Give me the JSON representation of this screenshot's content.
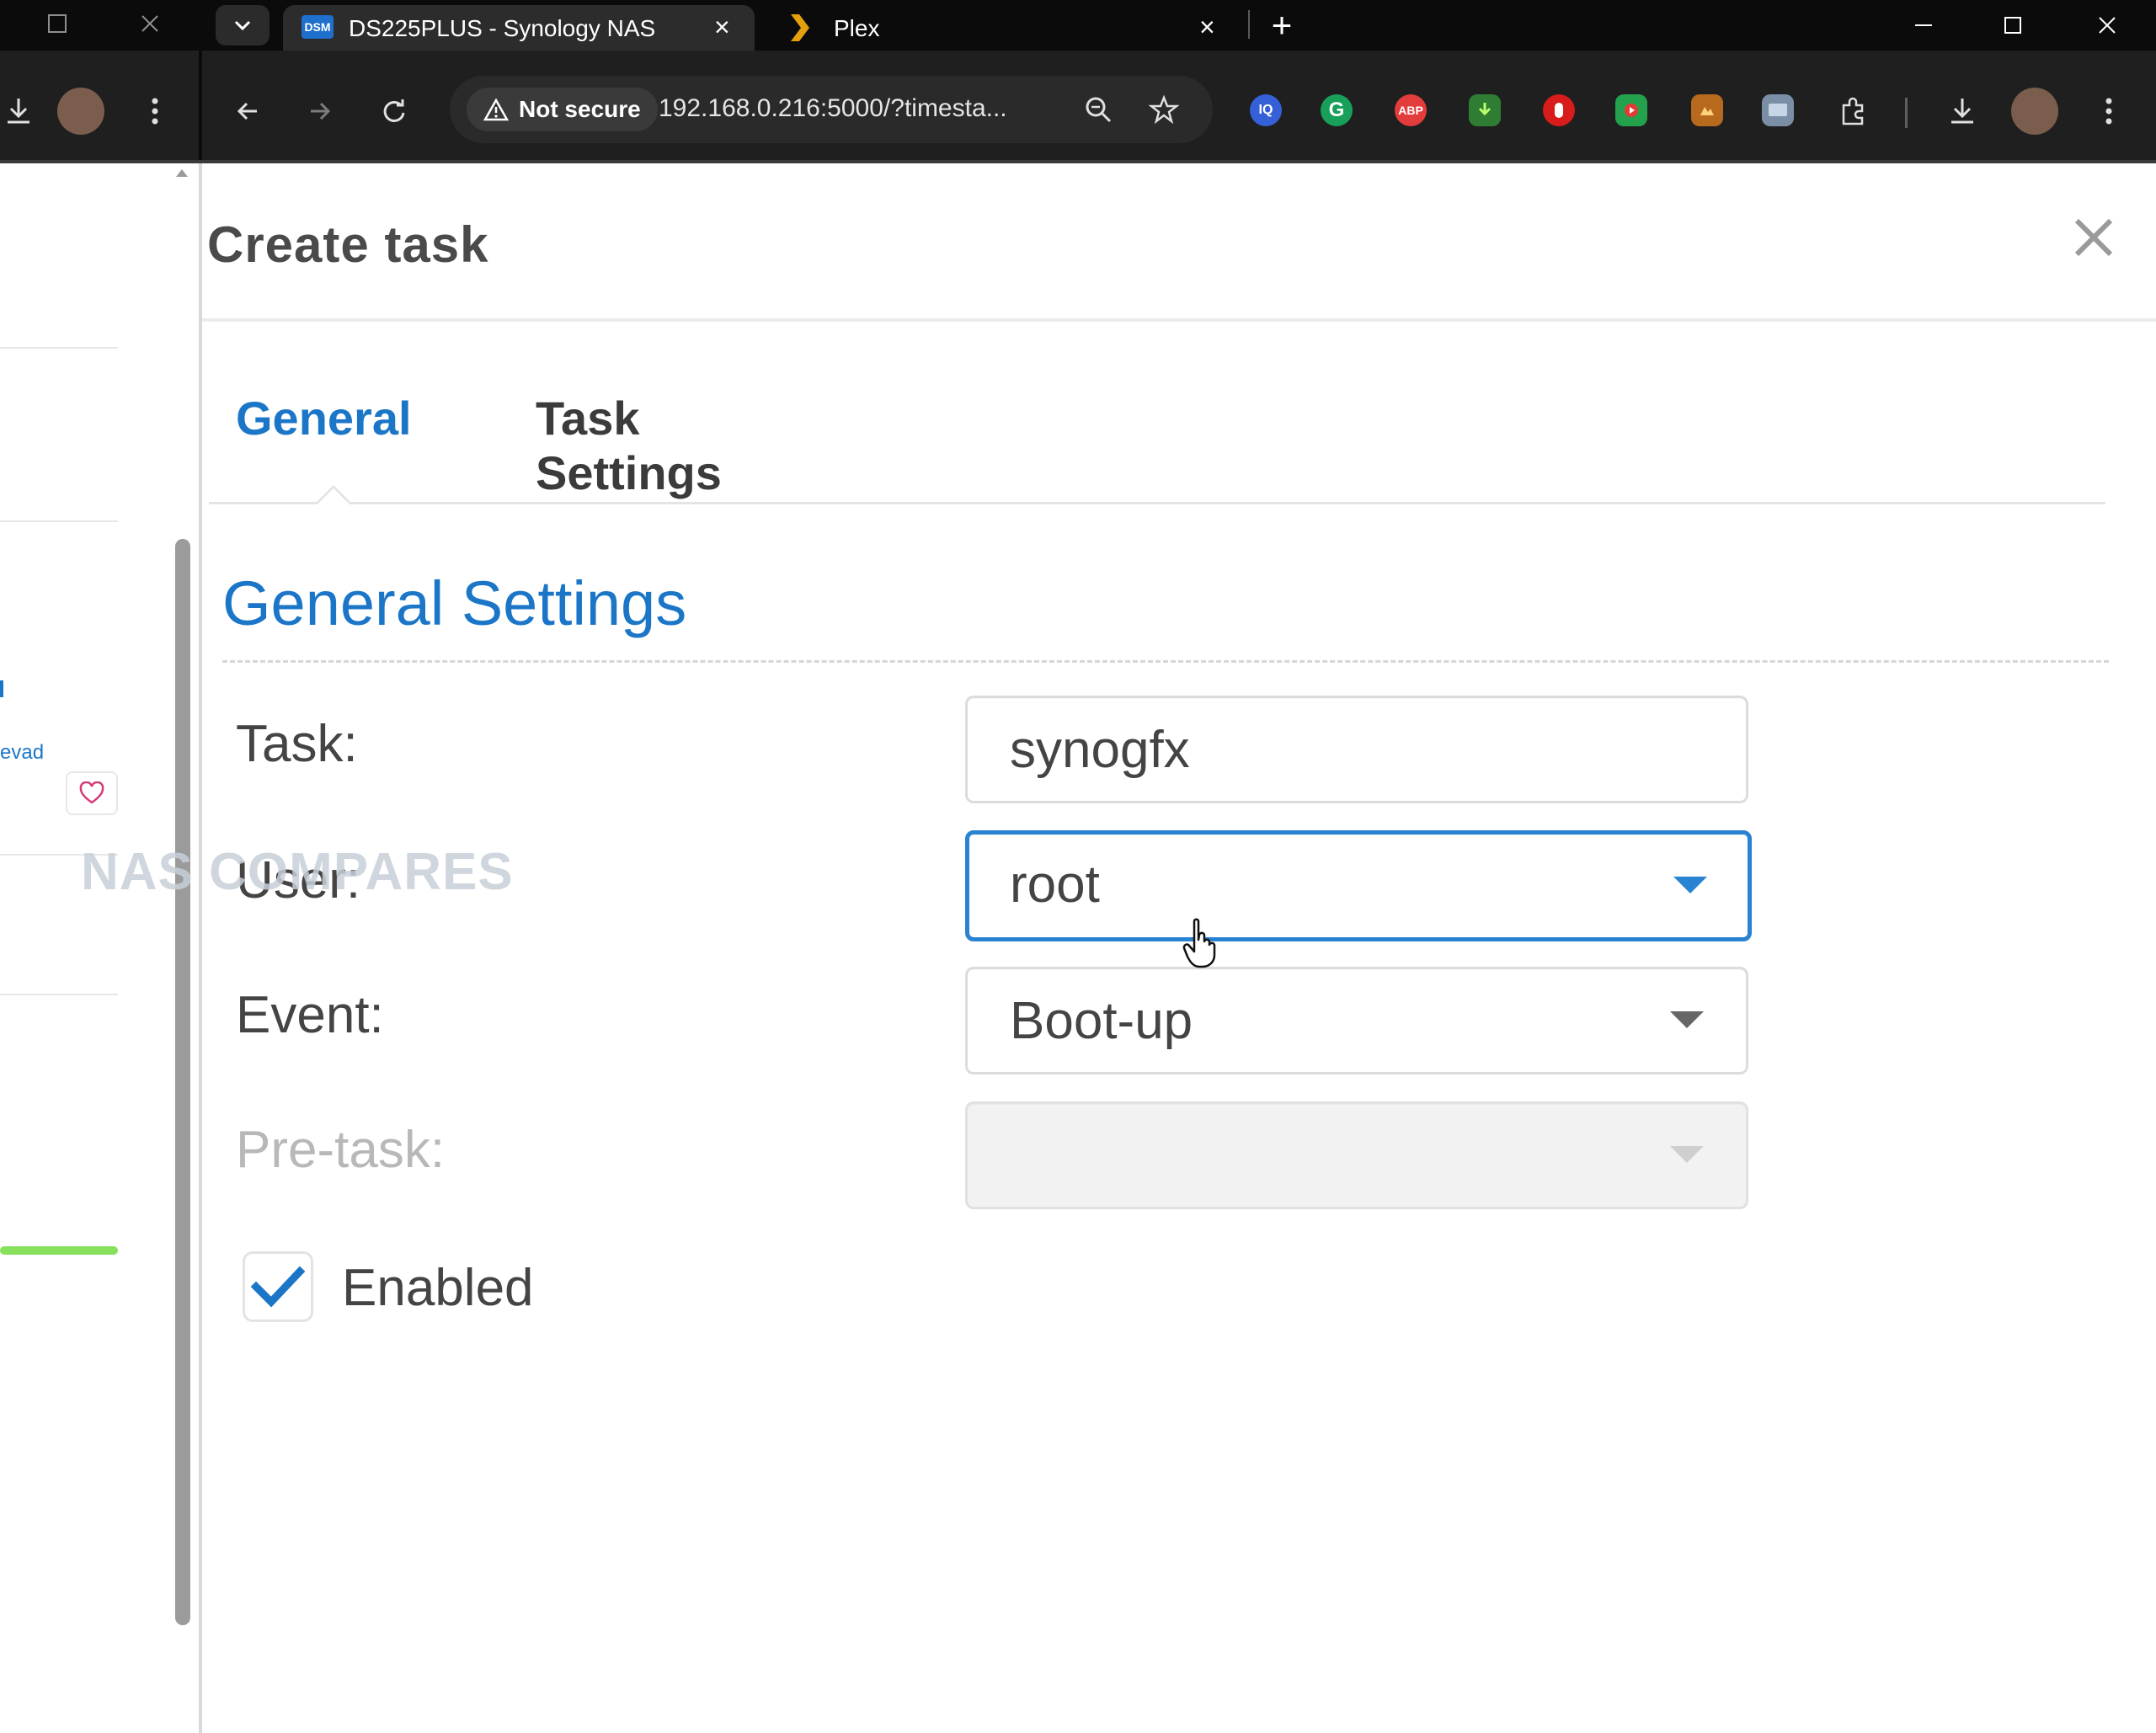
{
  "browser": {
    "tabs": [
      {
        "title": "DS225PLUS - Synology NAS",
        "favicon": "dsm-icon"
      },
      {
        "title": "Plex",
        "favicon": "plex-icon"
      }
    ],
    "address": {
      "security_label": "Not secure",
      "url": "192.168.0.216:5000/?timesta..."
    },
    "extensions": [
      "lastpass-icon",
      "grammarly-icon",
      "adblock-icon",
      "download-ext-icon",
      "hand-ext-icon",
      "video-ext-icon",
      "aura-ext-icon",
      "screen-ext-icon"
    ]
  },
  "left_panel": {
    "link_text": "evad"
  },
  "dialog": {
    "title": "Create task",
    "tabs": [
      {
        "label": "General",
        "active": true
      },
      {
        "label": "Task Settings",
        "active": false
      }
    ],
    "section_title": "General Settings",
    "fields": {
      "task": {
        "label": "Task:",
        "value": "synogfx"
      },
      "user": {
        "label": "User:",
        "value": "root"
      },
      "event": {
        "label": "Event:",
        "value": "Boot-up"
      },
      "pre_task": {
        "label": "Pre-task:",
        "value": ""
      }
    },
    "enabled": {
      "label": "Enabled",
      "checked": true
    }
  },
  "watermark": "NAS COMPARES",
  "colors": {
    "accent": "#1c76c8",
    "focus_border": "#2a82d2"
  }
}
